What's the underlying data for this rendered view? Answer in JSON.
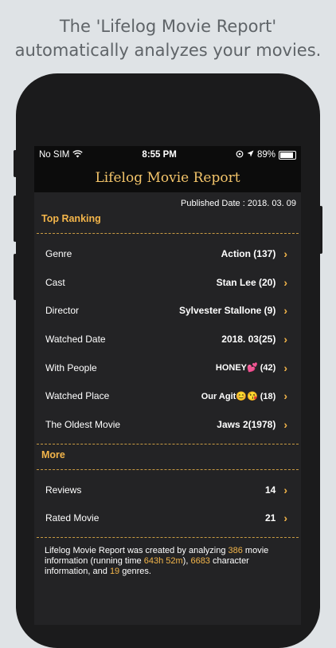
{
  "headline": {
    "line1": "The 'Lifelog Movie Report'",
    "line2": "automatically analyzes your movies."
  },
  "status": {
    "carrier": "No SIM",
    "time": "8:55 PM",
    "battery": "89%"
  },
  "nav": {
    "title": "Lifelog Movie Report"
  },
  "published": "Published Date : 2018. 03. 09",
  "top_ranking": {
    "title": "Top Ranking",
    "rows": [
      {
        "label": "Genre",
        "value": "Action (137)"
      },
      {
        "label": "Cast",
        "value": "Stan Lee (20)"
      },
      {
        "label": "Director",
        "value": "Sylvester Stallone (9)"
      },
      {
        "label": "Watched Date",
        "value": "2018. 03(25)"
      },
      {
        "label": "With People",
        "value": "HONEY💕  (42)"
      },
      {
        "label": "Watched Place",
        "value": "Our Agit😊😘 (18)"
      },
      {
        "label": "The Oldest Movie",
        "value": "Jaws 2(1978)"
      }
    ]
  },
  "more": {
    "title": "More",
    "rows": [
      {
        "label": "Reviews",
        "value": "14"
      },
      {
        "label": "Rated Movie",
        "value": "21"
      }
    ]
  },
  "footer": {
    "t1": "Lifelog Movie Report was created by analyzing ",
    "n1": "386",
    "t2": " movie information (running time ",
    "n2": "643h 52m",
    "t3": "), ",
    "n3": "6683",
    "t4": " character information, and ",
    "n4": "19",
    "t5": " genres."
  },
  "colors": {
    "accent": "#f3b54a",
    "title": "#f3c46a",
    "screen_bg": "#232325",
    "page_bg": "#dfe3e6"
  }
}
